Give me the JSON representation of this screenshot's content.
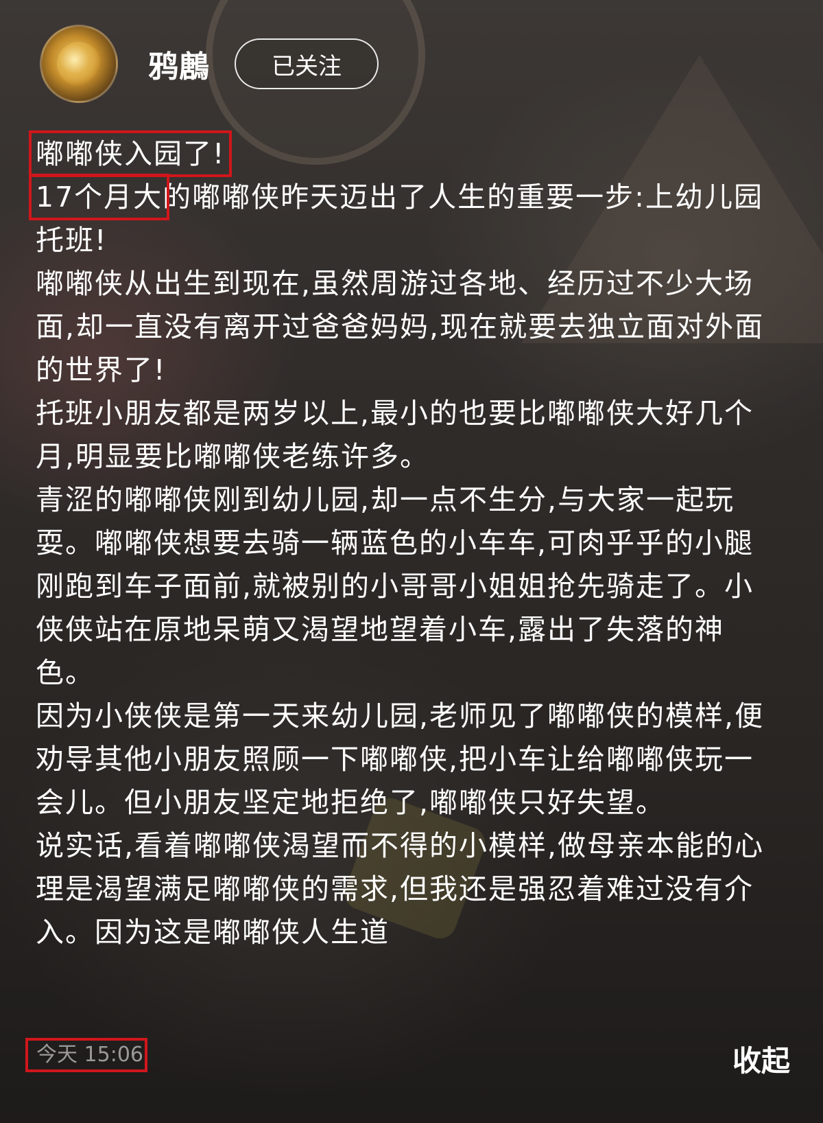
{
  "header": {
    "username": "鸦鶶",
    "follow_label": "已关注",
    "avatar_icon": "phoenix-avatar-icon"
  },
  "post": {
    "title": "嘟嘟侠入园了!",
    "p2_highlight": "17个月大",
    "p2_rest": "的嘟嘟侠昨天迈出了人生的重要一步:上幼儿园托班!",
    "p3": "嘟嘟侠从出生到现在,虽然周游过各地、经历过不少大场面,却一直没有离开过爸爸妈妈,现在就要去独立面对外面的世界了!",
    "p4": "托班小朋友都是两岁以上,最小的也要比嘟嘟侠大好几个月,明显要比嘟嘟侠老练许多。",
    "p5": "青涩的嘟嘟侠刚到幼儿园,却一点不生分,与大家一起玩耍。嘟嘟侠想要去骑一辆蓝色的小车车,可肉乎乎的小腿刚跑到车子面前,就被别的小哥哥小姐姐抢先骑走了。小侠侠站在原地呆萌又渴望地望着小车,露出了失落的神色。",
    "p6": "因为小侠侠是第一天来幼儿园,老师见了嘟嘟侠的模样,便劝导其他小朋友照顾一下嘟嘟侠,把小车让给嘟嘟侠玩一会儿。但小朋友坚定地拒绝了,嘟嘟侠只好失望。",
    "p7": "说实话,看着嘟嘟侠渴望而不得的小模样,做母亲本能的心理是渴望满足嘟嘟侠的需求,但我还是强忍着难过没有介入。因为这是嘟嘟侠人生道"
  },
  "footer": {
    "timestamp": "今天 15:06",
    "collapse_label": "收起"
  },
  "colors": {
    "highlight_border": "#d0161b",
    "text": "#ffffff"
  }
}
